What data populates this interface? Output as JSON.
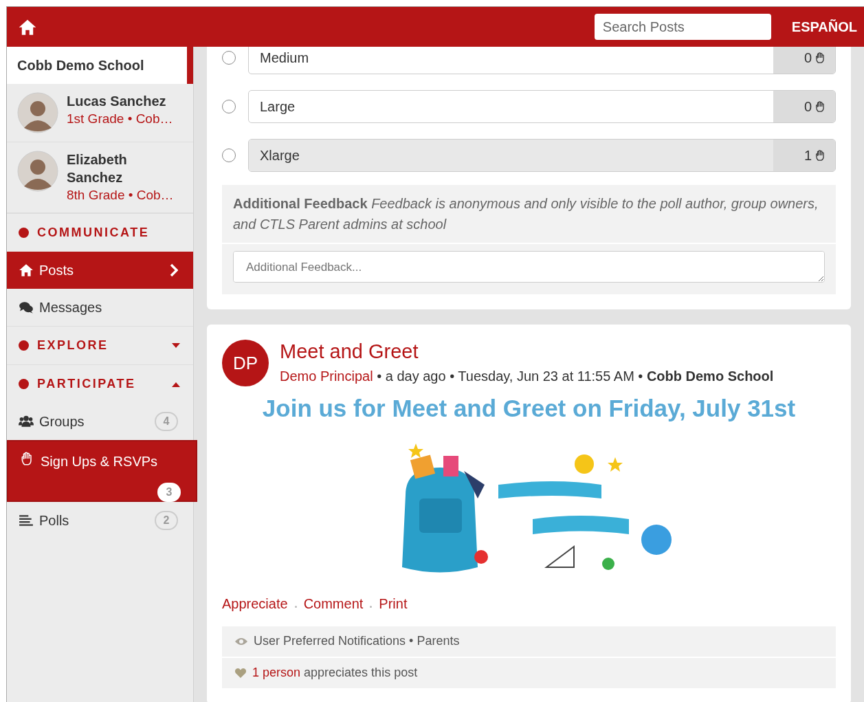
{
  "header": {
    "search": {
      "placeholder": "Search Posts"
    },
    "language": "ESPAÑOL"
  },
  "sidebar": {
    "school": "Cobb Demo School",
    "students": [
      {
        "name": "Lucas Sanchez",
        "detail": "1st Grade • Cob…"
      },
      {
        "name": "Elizabeth Sanchez",
        "detail": "8th Grade • Cob…"
      }
    ],
    "sections": [
      {
        "title": "COMMUNICATE",
        "items": [
          {
            "label": "Posts",
            "selected": true
          },
          {
            "label": "Messages",
            "selected": false
          }
        ]
      },
      {
        "title": "EXPLORE",
        "expanded": false
      },
      {
        "title": "PARTICIPATE",
        "expanded": true,
        "items": [
          {
            "label": "Groups",
            "badge": "4",
            "selected": false
          },
          {
            "label": "Sign Ups & RSVPs",
            "badge": "3",
            "selected": true
          },
          {
            "label": "Polls",
            "badge": "2",
            "selected": false
          }
        ]
      }
    ]
  },
  "poll": {
    "options": [
      {
        "label": "Medium",
        "count": "0",
        "selected": false,
        "level": 0
      },
      {
        "label": "Large",
        "count": "0",
        "selected": false,
        "level": 0
      },
      {
        "label": "Xlarge",
        "count": "1",
        "selected": false,
        "level": 1
      }
    ],
    "feedback": {
      "note": "**Additional Feedback** *Feedback is anonymous and only visible to the poll author, group owners, and CTLS Parent admins at school*",
      "placeholder": "Additional Feedback..."
    }
  },
  "post": {
    "avatar": "DP",
    "title": "Meet and Greet",
    "author": "Demo Principal",
    "meta": " • a day ago • Tuesday, Jun 23 at 11:55 AM • **Cobb Demo School**",
    "headline": "Join us for Meet and Greet on Friday, July 31st",
    "actions": [
      "Appreciate",
      "Comment",
      "Print"
    ],
    "audience": "User Preferred Notifications • Parents",
    "appreciation": {
      "count": "1 person",
      "text": " appreciates this post"
    }
  }
}
